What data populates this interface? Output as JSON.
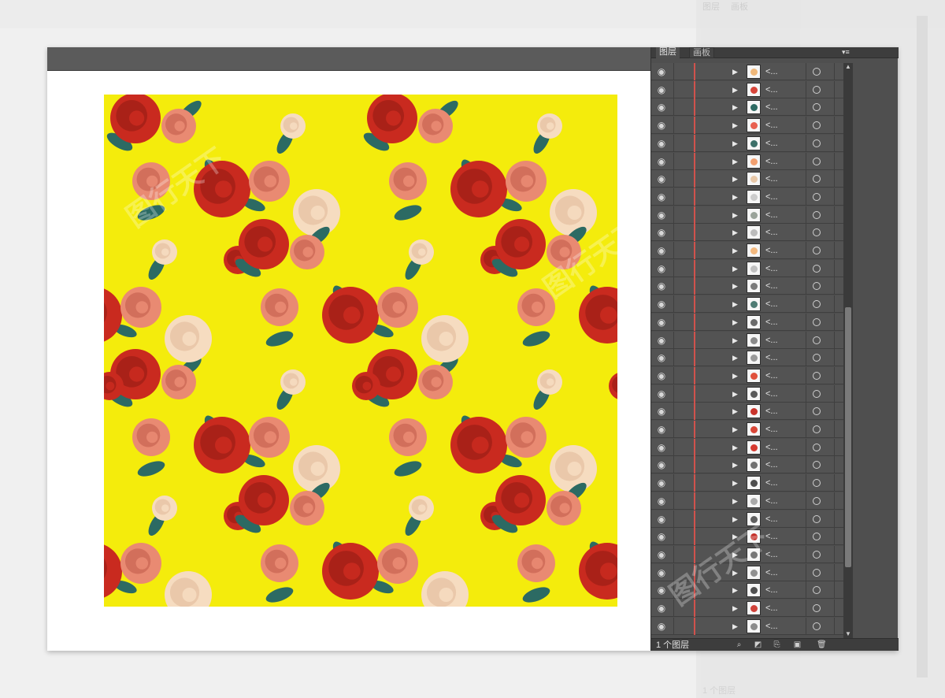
{
  "layers_panel": {
    "tabs": [
      "图层",
      "画板"
    ],
    "active_tab": "图层",
    "layer_count_label": "1 个图层",
    "layer_name_placeholder": "<..."
  },
  "layer_rows": [
    {
      "thumb": "#f0b87a"
    },
    {
      "thumb": "#d7453a"
    },
    {
      "thumb": "#2e6b63"
    },
    {
      "thumb": "#e86050"
    },
    {
      "thumb": "#3c6f68"
    },
    {
      "thumb": "#f2a070"
    },
    {
      "thumb": "#e8c8a8"
    },
    {
      "thumb": "#cccccc"
    },
    {
      "thumb": "#9aa39a"
    },
    {
      "thumb": "#bcbcbc"
    },
    {
      "thumb": "#f3b97f"
    },
    {
      "thumb": "#c0c0c0"
    },
    {
      "thumb": "#7a7a7a"
    },
    {
      "thumb": "#4f7c74"
    },
    {
      "thumb": "#6a6a6a"
    },
    {
      "thumb": "#8a8a8a"
    },
    {
      "thumb": "#9a9a9a"
    },
    {
      "thumb": "#e0513c"
    },
    {
      "thumb": "#5a5a5a"
    },
    {
      "thumb": "#c9342c"
    },
    {
      "thumb": "#d94738"
    },
    {
      "thumb": "#d63a30"
    },
    {
      "thumb": "#707070"
    },
    {
      "thumb": "#4d4d4d"
    },
    {
      "thumb": "#aaaaaa"
    },
    {
      "thumb": "#606060"
    },
    {
      "thumb": "#c42e28"
    },
    {
      "thumb": "#777777"
    },
    {
      "thumb": "#909090"
    },
    {
      "thumb": "#505050"
    },
    {
      "thumb": "#d0423a"
    },
    {
      "thumb": "#8c8c8c"
    }
  ],
  "colors": {
    "artboard_yellow": "#f4ec0c",
    "rose_red": "#c92a1f",
    "rose_pink": "#e98a72",
    "rose_cream": "#f6dcc0",
    "leaf_teal": "#2c6a63",
    "panel_bg": "#4f4f4f"
  }
}
